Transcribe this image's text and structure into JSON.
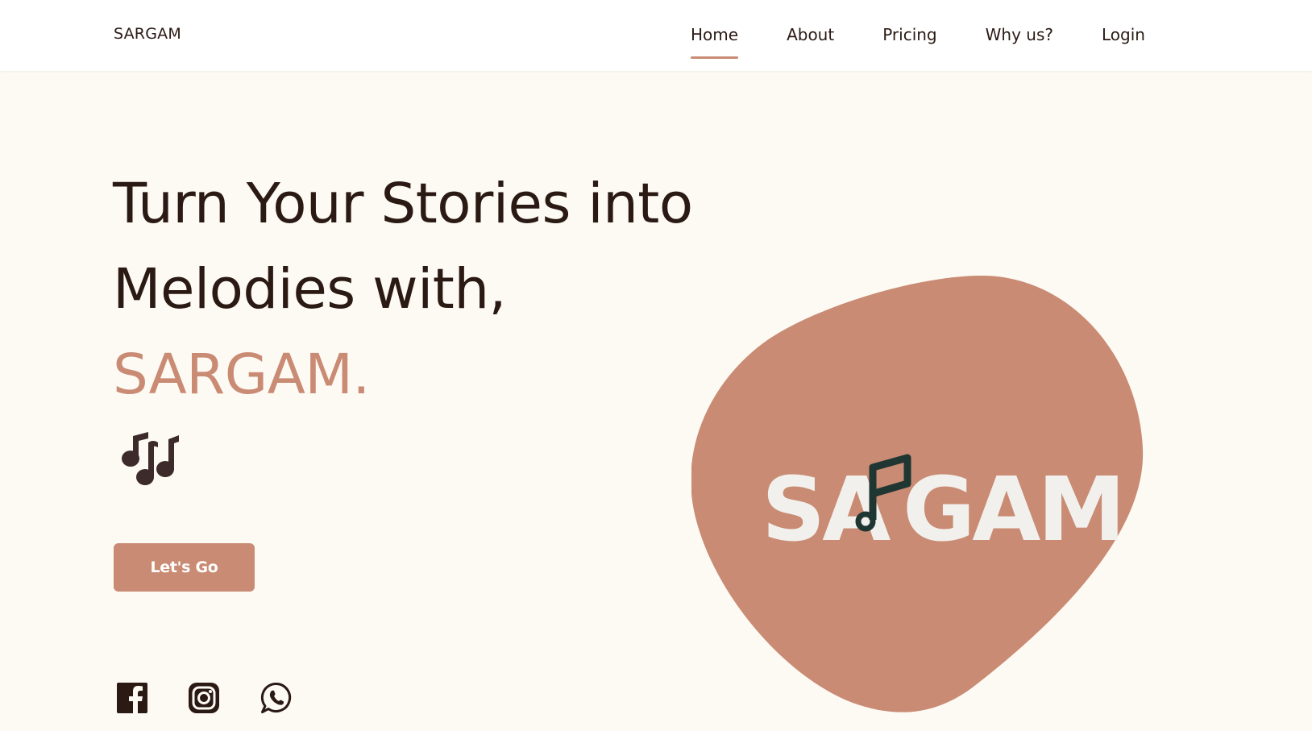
{
  "nav": {
    "brand": "SARGAM",
    "links": [
      {
        "label": "Home",
        "active": true
      },
      {
        "label": "About",
        "active": false
      },
      {
        "label": "Pricing",
        "active": false
      },
      {
        "label": "Why us?",
        "active": false
      },
      {
        "label": "Login",
        "active": false
      }
    ]
  },
  "hero": {
    "title_line1": "Turn Your Stories into",
    "title_line2": "Melodies with,",
    "title_accent": "SARGAM.",
    "cta_label": "Let's Go"
  },
  "logo": {
    "text_left": "SA",
    "text_right": "GAM"
  },
  "icons": {
    "notes": "music-notes-icon",
    "social": [
      "facebook-icon",
      "instagram-icon",
      "whatsapp-icon"
    ]
  },
  "colors": {
    "background": "#fdfaf4",
    "accent": "#c98b73",
    "text": "#2b1a14",
    "logo_text": "#f2f0ec",
    "logo_note": "#1f3633"
  }
}
